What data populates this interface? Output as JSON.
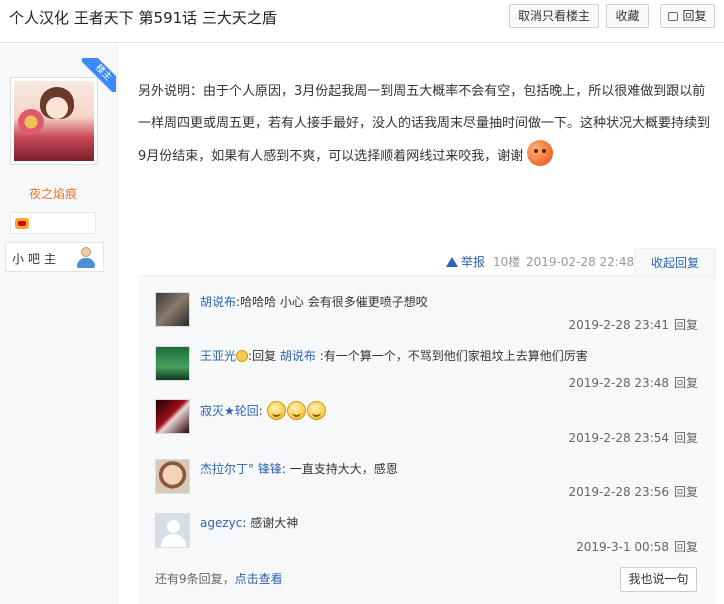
{
  "header": {
    "title": "个人汉化 王者天下 第591话 三大天之盾",
    "buttons": {
      "only_op": "取消只看楼主",
      "favorite": "收藏",
      "reply": "回复"
    }
  },
  "author": {
    "tag": "楼主",
    "name": "夜之焰痕",
    "role": "小吧主"
  },
  "post": {
    "content_main": "另外说明：由于个人原因，3月份起我周一到周五大概率不会有空，包括晚上，所以很难做到跟以前一样周四更或周五更，若有人接手最好，没人的话我周末尽量抽时间做一下。这种状况大概要持续到9月份结束，如果有人感到不爽，可以选择顺着网线过来咬我，谢谢",
    "report": "举报",
    "floor": "10楼",
    "time": "2019-02-28 22:48",
    "collapse_reply": "收起回复"
  },
  "comments": [
    {
      "user": "胡说布",
      "sep": ":",
      "text": "哈哈哈 小心 会有很多催更喷子想咬",
      "time": "2019-2-28 23:41",
      "reply": "回复"
    },
    {
      "user": "王亚光",
      "sep": ":",
      "prefix": "回复 ",
      "target": "胡说布",
      "text": " :有一个算一个，不骂到他们家祖坟上去算他们厉害",
      "time": "2019-2-28 23:48",
      "reply": "回复"
    },
    {
      "user": "寂灭★轮回",
      "sep": ":",
      "text": "",
      "time": "2019-2-28 23:54",
      "reply": "回复"
    },
    {
      "user": "杰拉尔丁°  锋锋",
      "sep": ":",
      "text": " 一直支持大大，感恩",
      "time": "2019-2-28 23:56",
      "reply": "回复"
    },
    {
      "user": "agezyc",
      "sep": ":",
      "text": " 感谢大神",
      "time": "2019-3-1 00:58",
      "reply": "回复"
    }
  ],
  "comments_footer": {
    "more_text": "还有9条回复，",
    "more_link": "点击查看",
    "say_button": "我也说一句"
  }
}
